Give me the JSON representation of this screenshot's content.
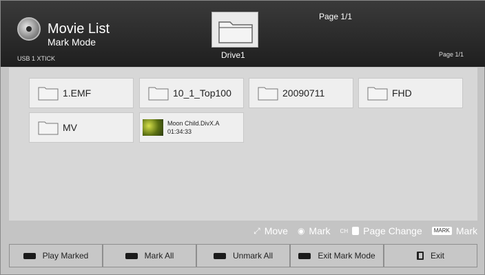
{
  "header": {
    "title": "Movie List",
    "mode": "Mark Mode",
    "device": "USB 1 XTICK",
    "page_top": "Page 1/1",
    "page_right": "Page 1/1",
    "drive_label": "Drive1",
    "drive_icon": "folder-icon"
  },
  "items": [
    {
      "label": "1.EMF",
      "type": "folder",
      "icon": "folder-icon"
    },
    {
      "label": "10_1_Top100",
      "type": "folder",
      "icon": "folder-icon"
    },
    {
      "label": "20090711",
      "type": "folder",
      "icon": "folder-icon"
    },
    {
      "label": "FHD",
      "type": "folder",
      "icon": "folder-icon"
    },
    {
      "label": "MV",
      "type": "folder",
      "icon": "folder-icon"
    },
    {
      "label": "Moon Child.DivX.A",
      "duration": "01:34:33",
      "type": "video",
      "icon": "video-thumbnail"
    }
  ],
  "hints": {
    "move": "Move",
    "mark": "Mark",
    "ch_label": "CH",
    "page_change": "Page Change",
    "mark_key": "MARK",
    "mark2": "Mark"
  },
  "buttons": {
    "play_marked": "Play Marked",
    "mark_all": "Mark All",
    "unmark_all": "Unmark All",
    "exit_mark_mode": "Exit Mark Mode",
    "exit": "Exit"
  },
  "colors": {
    "header_bg": "#2b2b2b",
    "content_bg": "#d7d7d7",
    "tile_bg": "#efefef"
  }
}
